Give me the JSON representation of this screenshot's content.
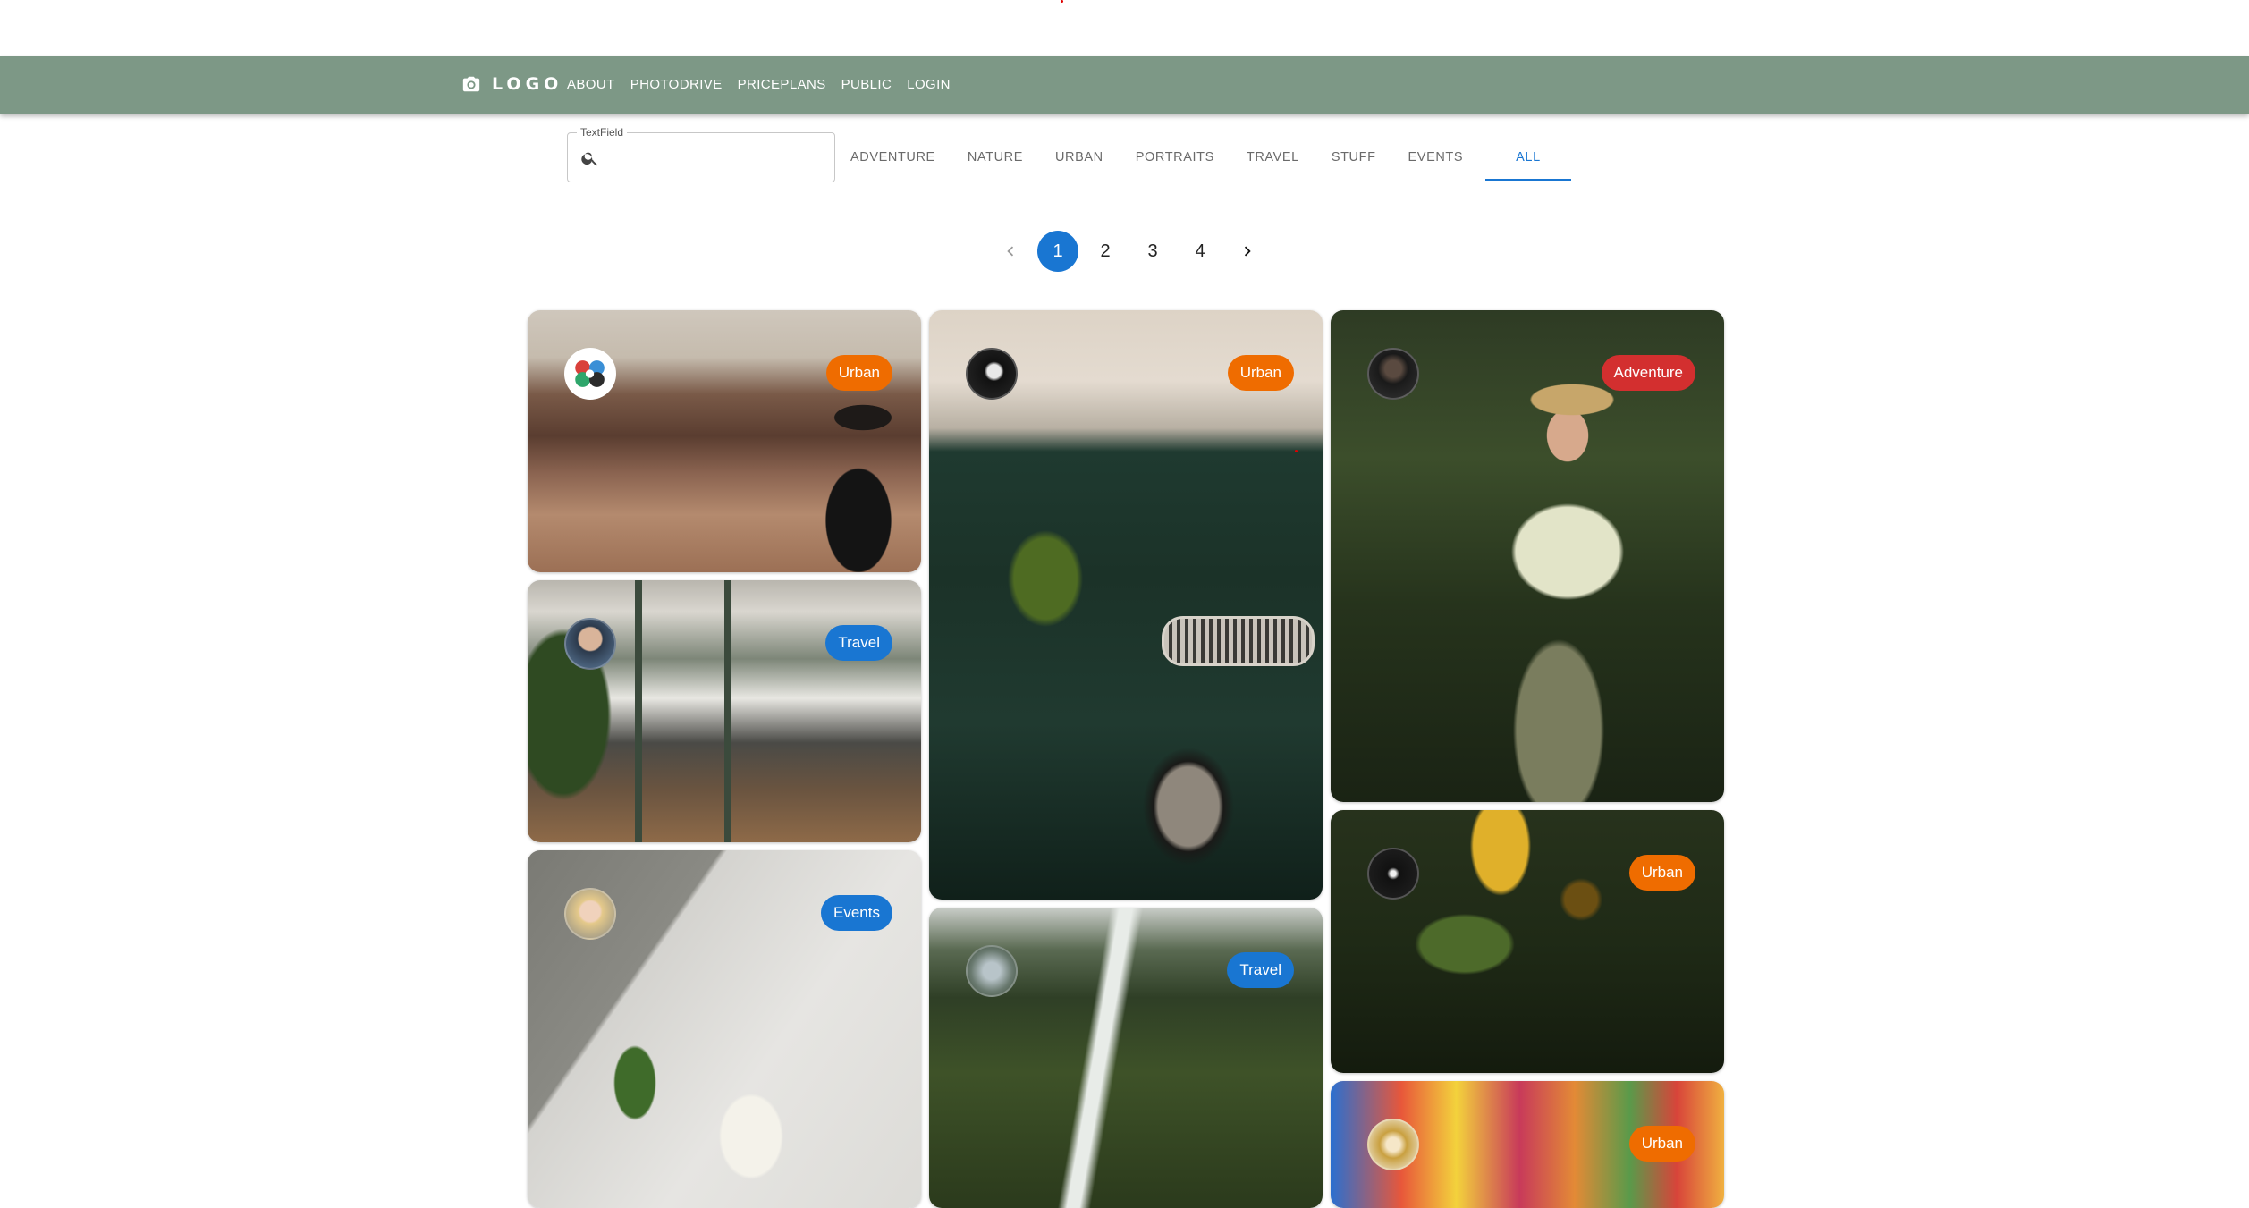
{
  "navbar": {
    "logo_text": "LOGO",
    "logo_icon": "camera-icon",
    "links": [
      "ABOUT",
      "PHOTODRIVE",
      "PRICEPLANS",
      "PUBLIC",
      "LOGIN"
    ]
  },
  "search": {
    "label": "TextField",
    "value": "",
    "icon": "search-icon"
  },
  "tabs": [
    "ADVENTURE",
    "NATURE",
    "URBAN",
    "PORTRAITS",
    "TRAVEL",
    "STUFF",
    "EVENTS",
    "ALL"
  ],
  "active_tab": "ALL",
  "pagination": {
    "pages": [
      "1",
      "2",
      "3",
      "4"
    ],
    "current": "1",
    "prev_icon": "chevron-left-icon",
    "next_icon": "chevron-right-icon"
  },
  "colors": {
    "navbar": "#7d9886",
    "accent": "#1976d2",
    "urban_chip": "#ef6c00",
    "travel_chip": "#1976d2",
    "events_chip": "#1976d2",
    "adventure_chip": "#d32f2f"
  },
  "cards": [
    {
      "category": "Urban",
      "chip_color": "#ef6c00"
    },
    {
      "category": "Travel",
      "chip_color": "#1976d2"
    },
    {
      "category": "Events",
      "chip_color": "#1976d2"
    },
    {
      "category": "Urban",
      "chip_color": "#ef6c00"
    },
    {
      "category": "Travel",
      "chip_color": "#1976d2"
    },
    {
      "category": "Adventure",
      "chip_color": "#d32f2f"
    },
    {
      "category": "Urban",
      "chip_color": "#ef6c00"
    },
    {
      "category": "Urban",
      "chip_color": "#ef6c00"
    }
  ]
}
